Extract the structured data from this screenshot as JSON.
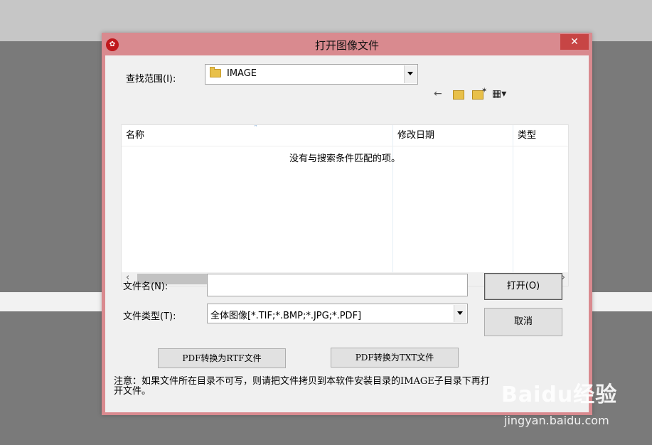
{
  "dialog": {
    "title": "打开图像文件",
    "close_glyph": "✕"
  },
  "lookin": {
    "label": "查找范围(I):",
    "value": "IMAGE"
  },
  "toolbar": {
    "back_glyph": "←",
    "new_folder_glyph": "✶",
    "view_glyph": "▦▾"
  },
  "list": {
    "columns": [
      "名称",
      "修改日期",
      "类型"
    ],
    "sort_glyph": "˄",
    "empty_message": "没有与搜索条件匹配的项。",
    "scroll_left": "‹",
    "scroll_right": "›"
  },
  "filename": {
    "label": "文件名(N):",
    "value": ""
  },
  "filetype": {
    "label": "文件类型(T):",
    "value": "全体图像[*.TIF;*.BMP;*.JPG;*.PDF]"
  },
  "buttons": {
    "open": "打开(O)",
    "cancel": "取消",
    "pdf_to_rtf": "PDF转换为RTF文件",
    "pdf_to_txt": "PDF转换为TXT文件"
  },
  "note": "注意：如果文件所在目录不可写，则请把文件拷贝到本软件安装目录的IMAGE子目录下再打开文件。",
  "watermark": {
    "logo": "Baidu经验",
    "url": "jingyan.baidu.com"
  },
  "icons": {
    "app": "app-logo-icon",
    "folder": "folder-icon",
    "back": "back-arrow-icon",
    "up": "up-folder-icon",
    "new_folder": "new-folder-icon",
    "view": "view-menu-icon"
  }
}
